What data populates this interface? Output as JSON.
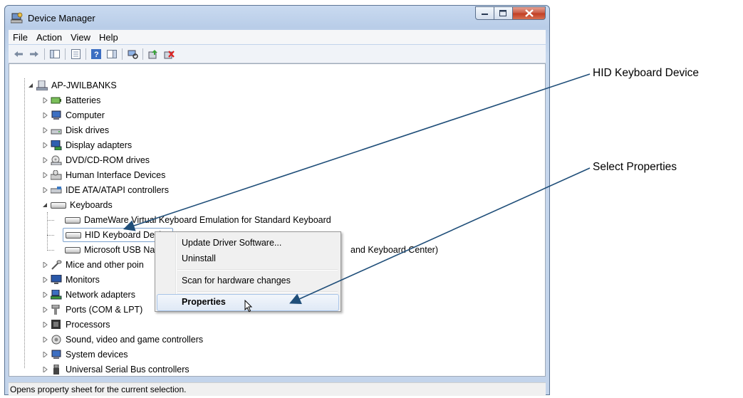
{
  "window": {
    "title": "Device Manager"
  },
  "menu": [
    "File",
    "Action",
    "View",
    "Help"
  ],
  "tree": {
    "root": "AP-JWILBANKS",
    "categories_before": [
      "Batteries",
      "Computer",
      "Disk drives",
      "Display adapters",
      "DVD/CD-ROM drives",
      "Human Interface Devices",
      "IDE ATA/ATAPI controllers"
    ],
    "keyboards_label": "Keyboards",
    "keyboard_devices": [
      "DameWare Virtual Keyboard Emulation for Standard Keyboard",
      "HID Keyboard Device",
      "Microsoft USB Na"
    ],
    "keyboard_device_tail": "and Keyboard Center)",
    "categories_after": [
      "Mice and other poin",
      "Monitors",
      "Network adapters",
      "Ports (COM & LPT)",
      "Processors",
      "Sound, video and game controllers",
      "System devices",
      "Universal Serial Bus controllers"
    ]
  },
  "context_menu": {
    "update": "Update Driver Software...",
    "uninstall": "Uninstall",
    "scan": "Scan for hardware changes",
    "properties": "Properties"
  },
  "status": "Opens property sheet for the current selection.",
  "callouts": {
    "hid": "HID Keyboard Device",
    "props": "Select Properties"
  },
  "colors": {
    "arrow": "#1f4e79",
    "selection_border": "#7da2ce",
    "titlebar": "#c9daf0"
  }
}
